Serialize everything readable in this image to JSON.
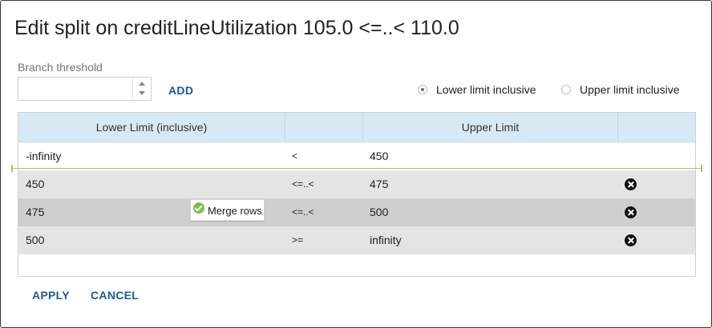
{
  "dialog": {
    "title": "Edit split on creditLineUtilization 105.0 <=..< 110.0"
  },
  "threshold": {
    "label": "Branch threshold",
    "value": "",
    "placeholder": "",
    "add_label": "ADD"
  },
  "inclusive": {
    "lower_label": "Lower limit inclusive",
    "upper_label": "Upper limit inclusive",
    "selected": "lower"
  },
  "table": {
    "headers": [
      "Lower Limit (inclusive)",
      "",
      "Upper Limit",
      ""
    ],
    "rows": [
      {
        "lower": "-infinity",
        "op": "<",
        "upper": "450",
        "deletable": false
      },
      {
        "lower": "450",
        "op": "<=..<",
        "upper": "475",
        "deletable": true
      },
      {
        "lower": "475",
        "op": "<=..<",
        "upper": "500",
        "deletable": true
      },
      {
        "lower": "500",
        "op": ">=",
        "upper": "infinity",
        "deletable": true
      }
    ]
  },
  "merge_tooltip": {
    "label": "Merge rows",
    "icon": "check-circle-icon"
  },
  "footer": {
    "apply_label": "APPLY",
    "cancel_label": "CANCEL"
  },
  "colors": {
    "accent": "#1a5a9a",
    "header_bg": "#d6e9f5",
    "split_line": "#9ccc65",
    "merge_check": "#7cc242"
  }
}
